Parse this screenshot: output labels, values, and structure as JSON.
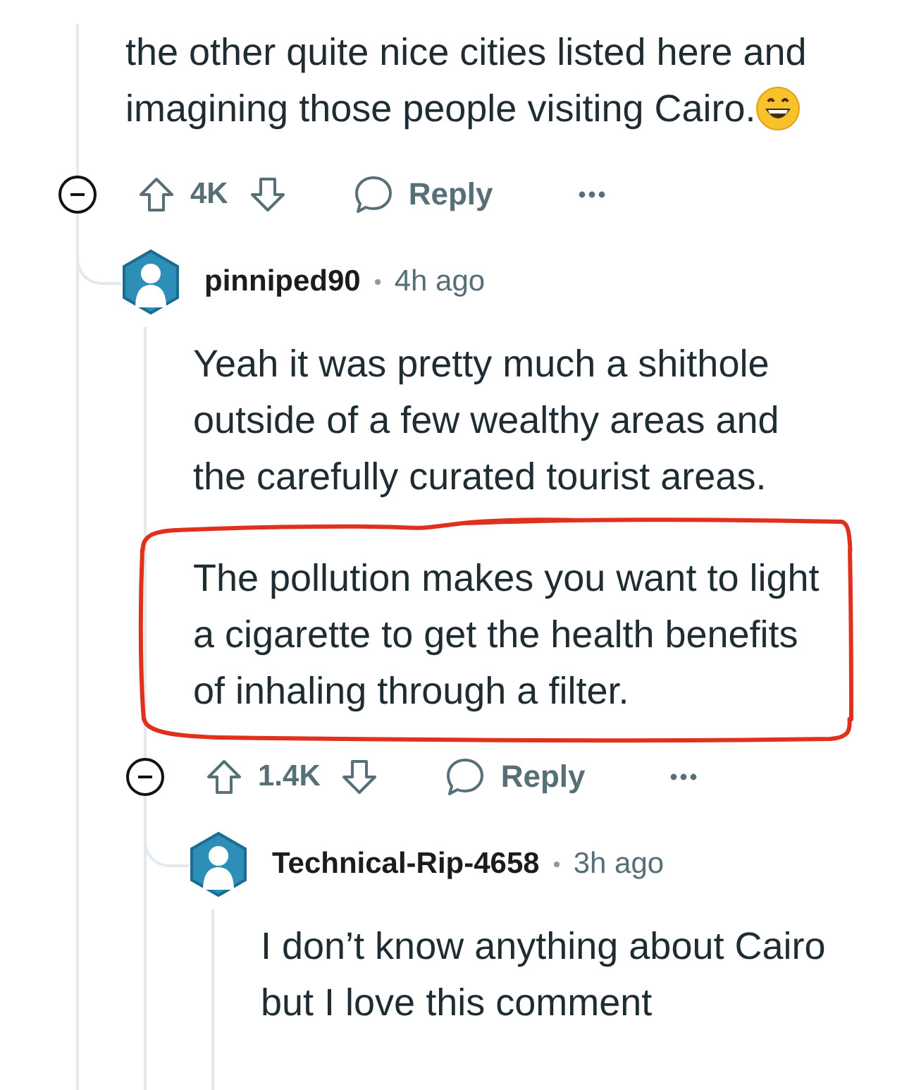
{
  "thread": {
    "paragraphs": [
      {
        "text": "the other quite nice cities listed here and imagining those people visiting Cairo.",
        "ends_with_emoji": true,
        "circled": false
      }
    ],
    "score": "4K",
    "reply": "Reply",
    "replies": [
      {
        "author": "pinniped90",
        "time": "4h ago",
        "paragraphs": [
          {
            "text": "Yeah it was pretty much a shithole outside of a few wealthy areas and the carefully curated tourist areas.",
            "ends_with_emoji": false,
            "circled": false
          },
          {
            "text": "The pollution makes you want to light a cigarette to get the health benefits of inhaling through a filter.",
            "ends_with_emoji": false,
            "circled": true
          }
        ],
        "score": "1.4K",
        "reply": "Reply",
        "replies": [
          {
            "author": "Technical-Rip-4658",
            "time": "3h ago",
            "paragraphs": [
              {
                "text": "I don’t know anything about Cairo but I love this comment",
                "ends_with_emoji": false,
                "circled": false
              }
            ]
          }
        ]
      }
    ]
  }
}
